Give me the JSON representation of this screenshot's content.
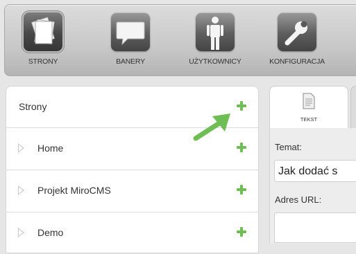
{
  "toolbar": {
    "items": [
      {
        "label": "STRONY",
        "icon": "pages-icon",
        "active": true
      },
      {
        "label": "BANERY",
        "icon": "speech-bubble-icon",
        "active": false
      },
      {
        "label": "UŻYTKOWNICY",
        "icon": "user-icon",
        "active": false
      },
      {
        "label": "KONFIGURACJA",
        "icon": "wrench-icon",
        "active": false
      }
    ]
  },
  "pages_panel": {
    "title": "Strony",
    "items": [
      {
        "label": "Home"
      },
      {
        "label": "Projekt MiroCMS"
      },
      {
        "label": "Demo"
      }
    ],
    "add_color": "#6fbe55",
    "arrow_color": "#6fbe55"
  },
  "editor": {
    "tabs": [
      {
        "label": "TEKST",
        "icon": "document-icon"
      }
    ],
    "fields": {
      "subject_label": "Temat:",
      "subject_value": "Jak dodać s",
      "url_label": "Adres URL:",
      "url_value": ""
    }
  }
}
